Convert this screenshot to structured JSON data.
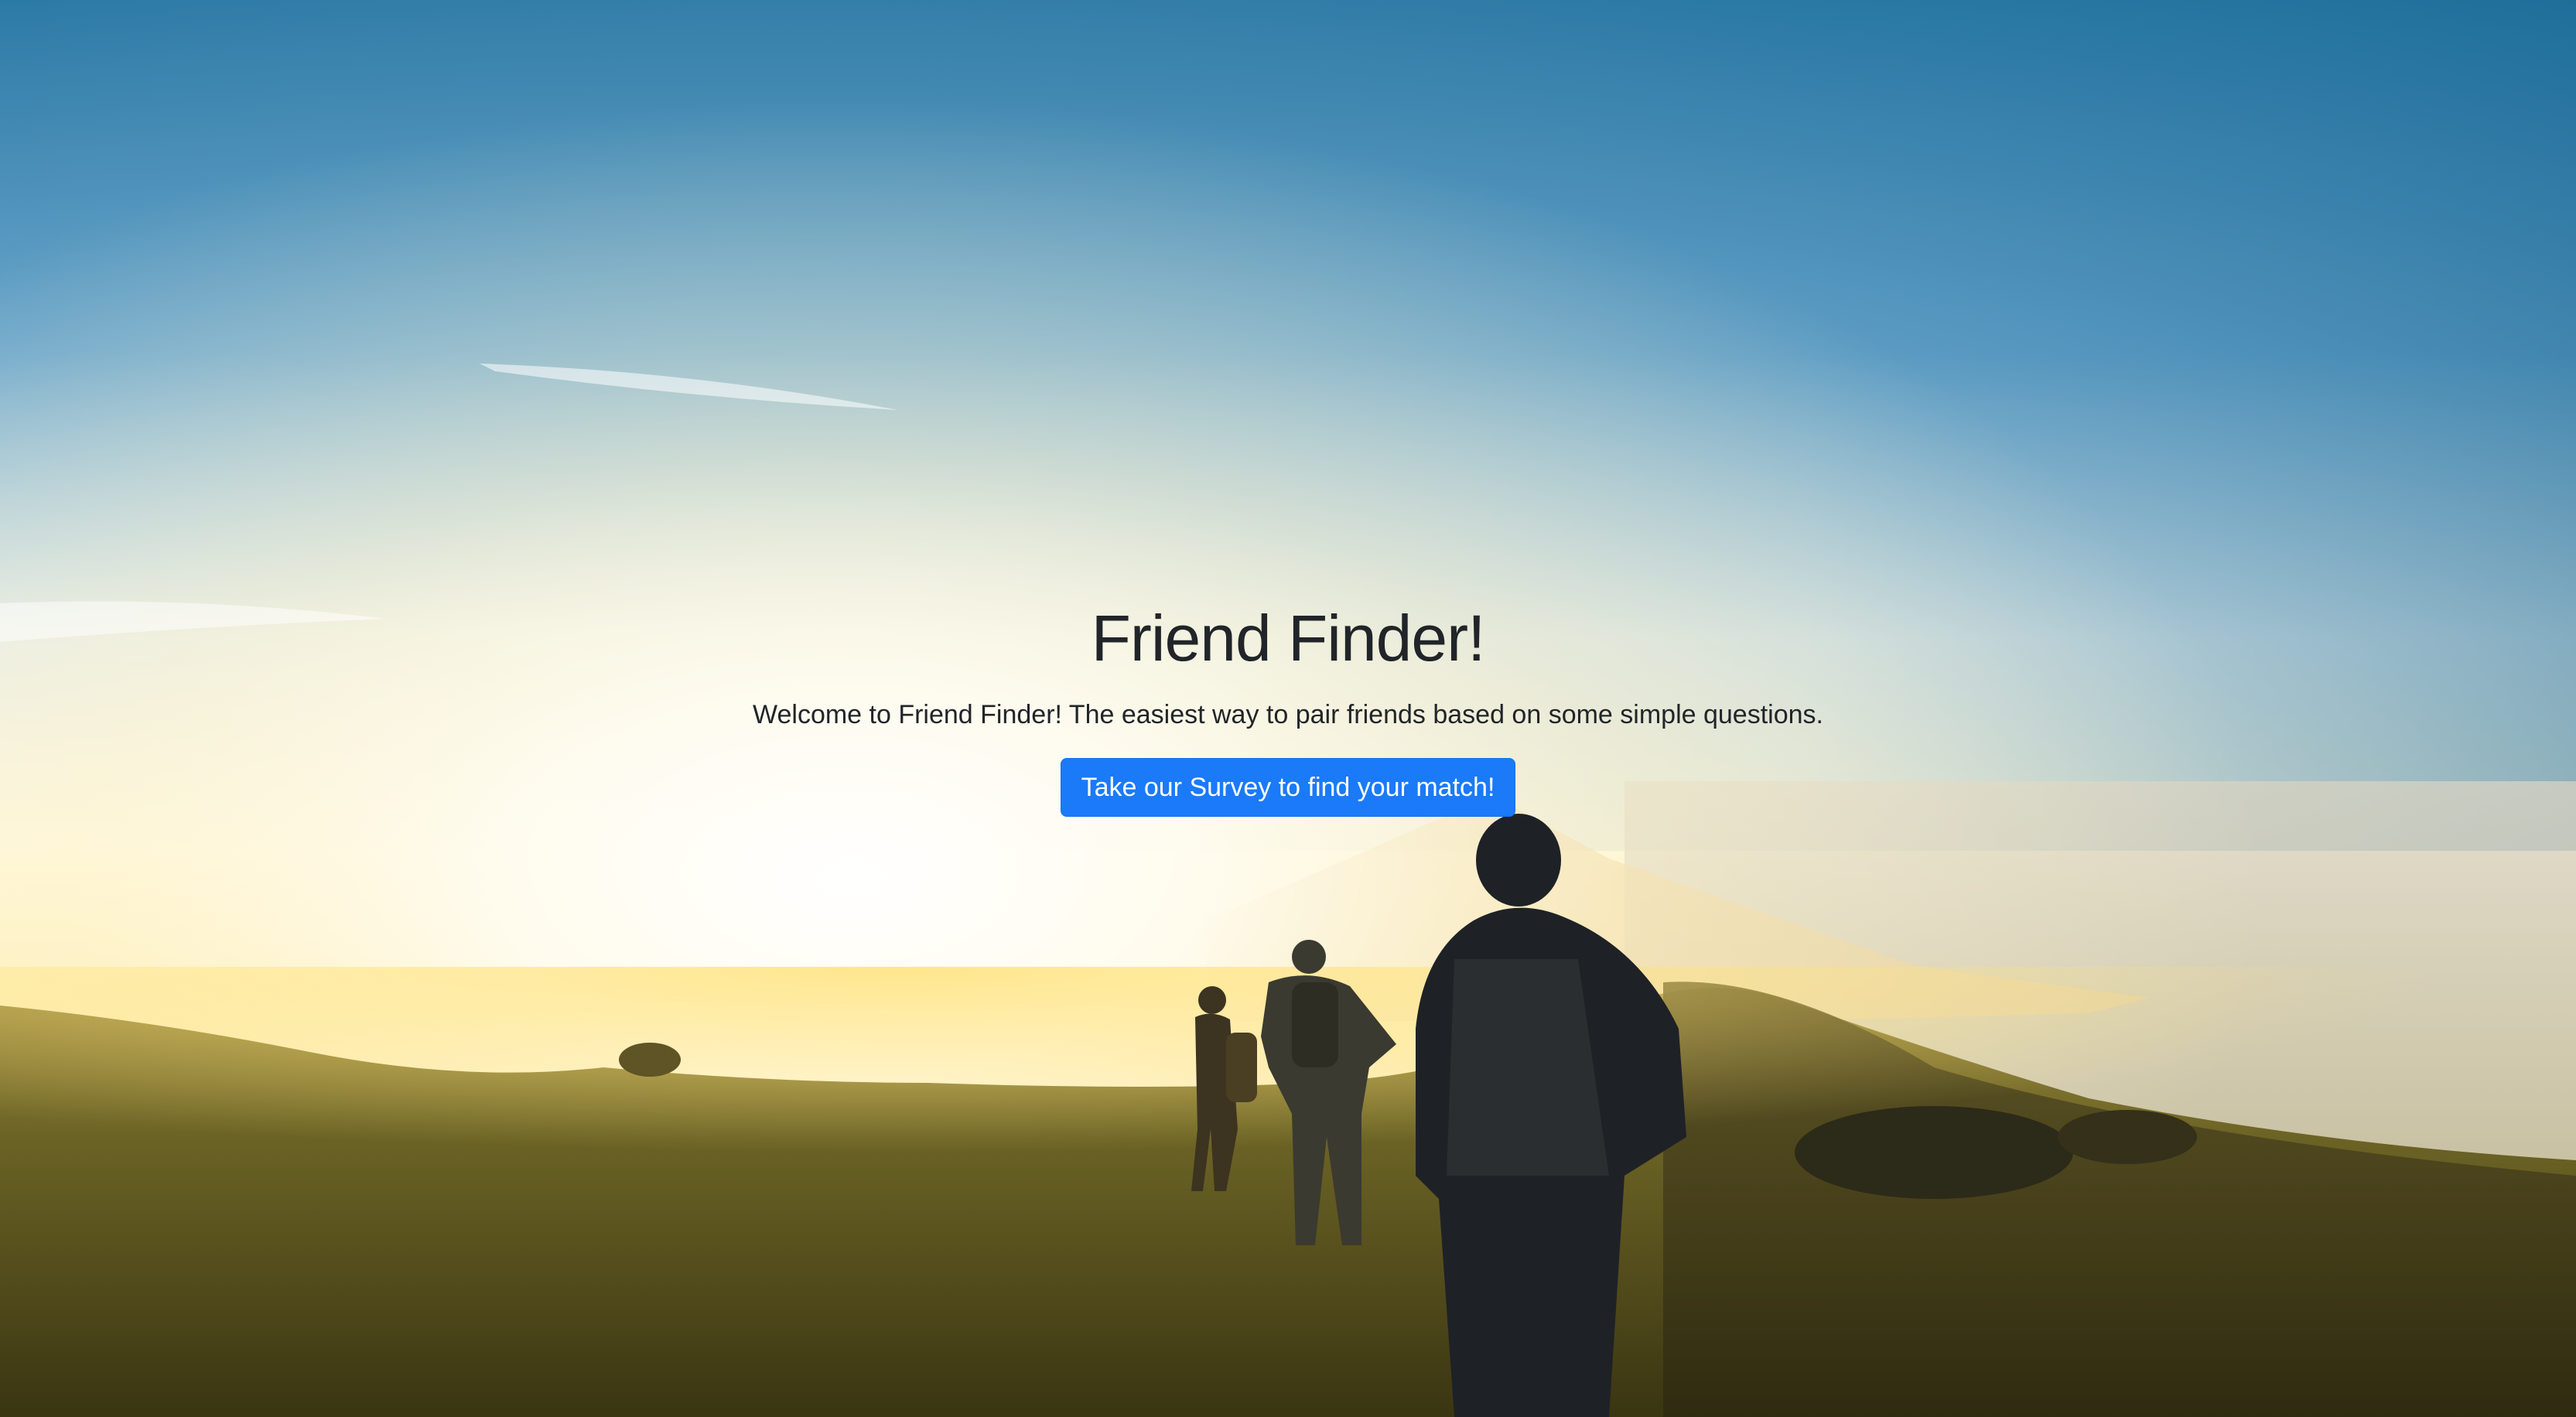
{
  "hero": {
    "title": "Friend Finder!",
    "lead": "Welcome to Friend Finder! The easiest way to pair friends based on some simple questions.",
    "cta_label": "Take our Survey to find your match!"
  },
  "colors": {
    "button_primary": "#1a7af8",
    "text_dark": "#212529",
    "sky_top": "#1e6d99",
    "sun_glow": "#fffdf0",
    "grass": "#4a4a1a"
  }
}
